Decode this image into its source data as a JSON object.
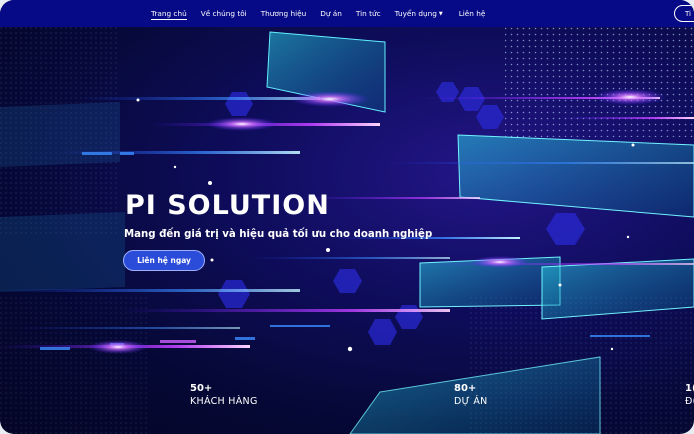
{
  "nav": {
    "items": [
      {
        "label": "Trang chủ",
        "active": true
      },
      {
        "label": "Về chúng tôi"
      },
      {
        "label": "Thương hiệu"
      },
      {
        "label": "Dự án"
      },
      {
        "label": "Tin tức"
      },
      {
        "label": "Tuyển dụng",
        "dropdown": true
      },
      {
        "label": "Liên hệ"
      }
    ],
    "button_label": "Ti"
  },
  "hero": {
    "title": "PI SOLUTION",
    "subtitle": "Mang đến giá trị và hiệu quả tối ưu cho doanh nghiệp",
    "cta_label": "Liên hệ ngay"
  },
  "stats": [
    {
      "number": "50+",
      "label": "KHÁCH HÀNG"
    },
    {
      "number": "80+",
      "label": "DỰ ÁN"
    },
    {
      "number": "1(",
      "label": "Đ("
    }
  ],
  "colors": {
    "nav_bg": "#070a86",
    "cta_bg": "#2a4cd8",
    "hero_dark": "#070a3a",
    "accent_cyan": "#36e0ff",
    "accent_magenta": "#d05cff"
  }
}
